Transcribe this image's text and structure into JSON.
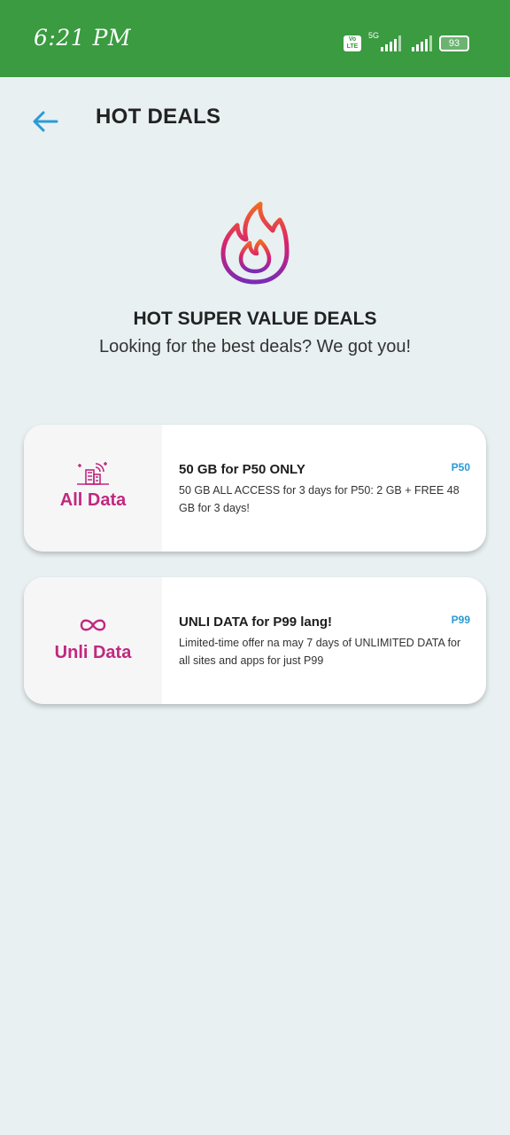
{
  "status_bar": {
    "time": "6:21 PM",
    "volte": "Vo LTE",
    "network": "5G",
    "battery": "93"
  },
  "header": {
    "title": "HOT DEALS"
  },
  "hero": {
    "title": "HOT SUPER VALUE DEALS",
    "subtitle": "Looking for the best deals? We got you!"
  },
  "deals": [
    {
      "category": "All Data",
      "category_icon": "all-data-icon",
      "title": "50 GB for P50 ONLY",
      "price": "P50",
      "description": "50 GB ALL ACCESS for 3 days for P50: 2 GB + FREE 48 GB for 3 days!"
    },
    {
      "category": "Unli Data",
      "category_icon": "infinity-icon",
      "title": "UNLI DATA for P99 lang!",
      "price": "P99",
      "description": "Limited-time offer na may 7 days of UNLIMITED DATA for all sites and apps for just P99"
    }
  ],
  "colors": {
    "status_bar": "#3a9b40",
    "background": "#e8f0f2",
    "accent": "#2a9ad6",
    "category": "#c0287f"
  }
}
